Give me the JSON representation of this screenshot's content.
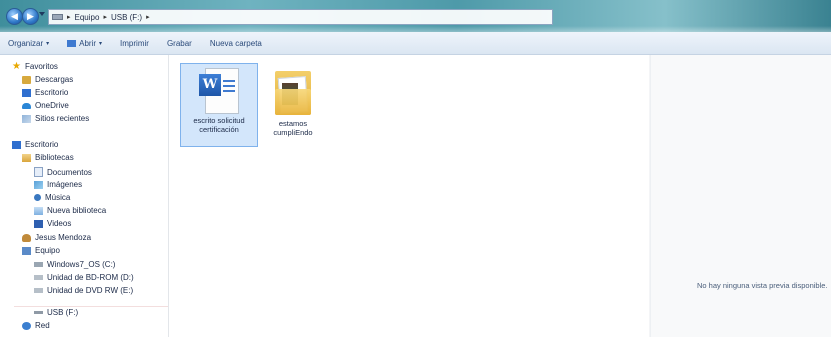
{
  "address_bar": {
    "segments": [
      "Equipo",
      "USB (F:)"
    ],
    "trailing_sep": "▸"
  },
  "toolbar": {
    "organize_label": "Organizar",
    "open_label": "Abrir",
    "print_label": "Imprimir",
    "burn_label": "Grabar",
    "new_folder_label": "Nueva carpeta",
    "dropdown_glyph": "▾"
  },
  "sidebar": {
    "favorites": {
      "header": "Favoritos",
      "items": [
        "Descargas",
        "Escritorio",
        "OneDrive",
        "Sitios recientes"
      ]
    },
    "desktop": {
      "header": "Escritorio",
      "libraries": {
        "header": "Bibliotecas",
        "items": [
          "Documentos",
          "Imágenes",
          "Música",
          "Nueva biblioteca",
          "Videos"
        ]
      },
      "user": "Jesus Mendoza",
      "computer": {
        "header": "Equipo",
        "items": [
          "Windows7_OS (C:)",
          "Unidad de BD-ROM (D:)",
          "Unidad de DVD RW (E:)",
          "USB (F:)"
        ]
      },
      "network": "Red"
    }
  },
  "files": [
    {
      "name_line1": "escrito solicitud",
      "name_line2": "certificación",
      "icon": "word-document-icon",
      "selected": true
    },
    {
      "name_line1": "estamos",
      "name_line2": "cumpliEndo",
      "icon": "folder-icon",
      "selected": false
    }
  ],
  "preview": {
    "message": "No hay ninguna vista previa disponible."
  },
  "colors": {
    "selection": "#d3e6fb",
    "link_text": "#2a4a7a"
  }
}
